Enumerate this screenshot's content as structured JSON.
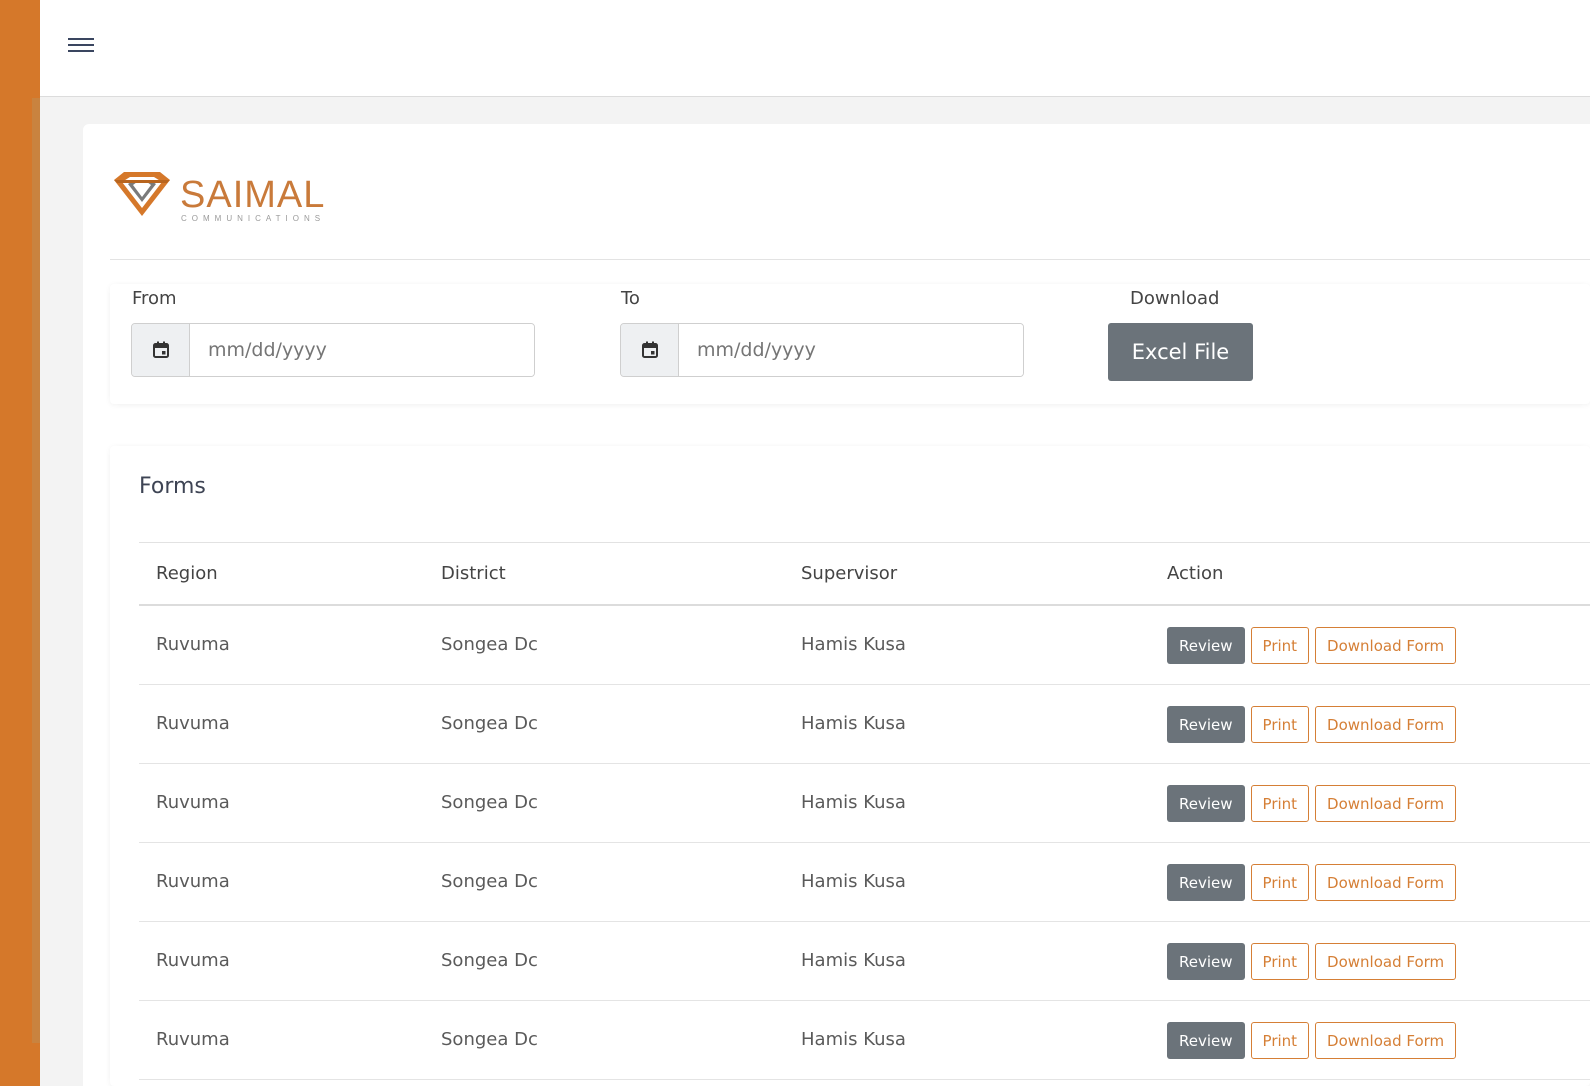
{
  "brand": {
    "name": "SAIMAL",
    "subtitle": "COMMUNICATIONS",
    "accent_color": "#d5782a"
  },
  "filters": {
    "from_label": "From",
    "to_label": "To",
    "download_label": "Download",
    "from_placeholder": "mm/dd/yyyy",
    "to_placeholder": "mm/dd/yyyy",
    "excel_button": "Excel File"
  },
  "forms": {
    "title": "Forms",
    "columns": [
      "Region",
      "District",
      "Supervisor",
      "Action"
    ],
    "actions": {
      "review": "Review",
      "print": "Print",
      "download": "Download Form"
    },
    "rows": [
      {
        "region": "Ruvuma",
        "district": "Songea Dc",
        "supervisor": "Hamis Kusa"
      },
      {
        "region": "Ruvuma",
        "district": "Songea Dc",
        "supervisor": "Hamis Kusa"
      },
      {
        "region": "Ruvuma",
        "district": "Songea Dc",
        "supervisor": "Hamis Kusa"
      },
      {
        "region": "Ruvuma",
        "district": "Songea Dc",
        "supervisor": "Hamis Kusa"
      },
      {
        "region": "Ruvuma",
        "district": "Songea Dc",
        "supervisor": "Hamis Kusa"
      },
      {
        "region": "Ruvuma",
        "district": "Songea Dc",
        "supervisor": "Hamis Kusa"
      }
    ]
  }
}
